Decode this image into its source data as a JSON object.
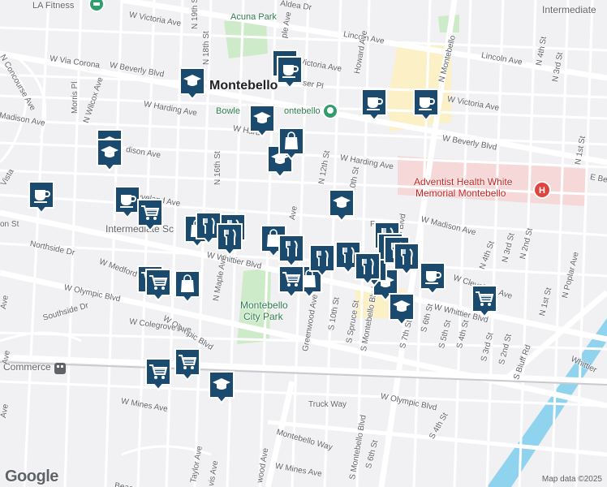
{
  "attribution": "Map data ©2025",
  "logo": "Google",
  "labels": [
    {
      "id": "la-fitness",
      "text": "LA Fitness",
      "cls": "poi-d"
    },
    {
      "id": "aldea",
      "text": "Aldea Dr",
      "cls": ""
    },
    {
      "id": "intermediate-top",
      "text": "Intermediate",
      "cls": "corner"
    },
    {
      "id": "acuna-park",
      "text": "Acuna Park",
      "cls": "poi-g"
    },
    {
      "id": "victoria-w1",
      "text": "W Victoria Ave",
      "cls": ""
    },
    {
      "id": "victoria-w2",
      "text": "Victoria Ave",
      "cls": ""
    },
    {
      "id": "lincoln-w",
      "text": "Lincoln Ave",
      "cls": ""
    },
    {
      "id": "lincoln-e",
      "text": "Lincoln Ave",
      "cls": ""
    },
    {
      "id": "via-corona",
      "text": "W Via Corona",
      "cls": ""
    },
    {
      "id": "beverly-w",
      "text": "W Beverly Blvd",
      "cls": ""
    },
    {
      "id": "beverly-e",
      "text": "W Beverly Blvd",
      "cls": ""
    },
    {
      "id": "concourse",
      "text": "N Concourse Ave",
      "cls": ""
    },
    {
      "id": "wilcox",
      "text": "N Wilcox Ave",
      "cls": ""
    },
    {
      "id": "morris",
      "text": "Morris Pl",
      "cls": ""
    },
    {
      "id": "montebello",
      "text": "Montebello",
      "cls": "city"
    },
    {
      "id": "harding-w",
      "text": "W Harding Ave",
      "cls": ""
    },
    {
      "id": "harding-c",
      "text": "W Hardi",
      "cls": ""
    },
    {
      "id": "harding-e",
      "text": "W Harding Ave",
      "cls": ""
    },
    {
      "id": "bowl",
      "text": "Bowle",
      "cls": "poi-g"
    },
    {
      "id": "bowl2",
      "text": "ontebello",
      "cls": "poi-g"
    },
    {
      "id": "madison-w",
      "text": "Madison Ave",
      "cls": ""
    },
    {
      "id": "madison-c",
      "text": "dison Ave",
      "cls": ""
    },
    {
      "id": "madison-e",
      "text": "W Madison Ave",
      "cls": ""
    },
    {
      "id": "vic-e",
      "text": "W Victoria Ave",
      "cls": ""
    },
    {
      "id": "n19",
      "text": "N 19th St",
      "cls": ""
    },
    {
      "id": "n18",
      "text": "N 18th St",
      "cls": ""
    },
    {
      "id": "n16",
      "text": "N 16th St",
      "cls": ""
    },
    {
      "id": "n12",
      "text": "N 12th St",
      "cls": ""
    },
    {
      "id": "n10",
      "text": "N 10th St",
      "cls": ""
    },
    {
      "id": "howard",
      "text": "Howard Ave",
      "cls": ""
    },
    {
      "id": "nmontebello-top",
      "text": "N Montebello",
      "cls": ""
    },
    {
      "id": "adventist1",
      "text": "Adventist Health White",
      "cls": "poi-r"
    },
    {
      "id": "adventist2",
      "text": "Memorial Montebello",
      "cls": "poi-r"
    },
    {
      "id": "cleveland-w",
      "text": "Cleveland Ave",
      "cls": ""
    },
    {
      "id": "cleveland-e",
      "text": "W Cleveland Ave",
      "cls": ""
    },
    {
      "id": "whittier-w",
      "text": "W Whittier Blvd",
      "cls": ""
    },
    {
      "id": "whittier-c",
      "text": "W Wh",
      "cls": ""
    },
    {
      "id": "whittier-e",
      "text": "W Whittier Blvd",
      "cls": ""
    },
    {
      "id": "whittier-far",
      "text": "Whittier",
      "cls": ""
    },
    {
      "id": "northside",
      "text": "Northside Dr",
      "cls": ""
    },
    {
      "id": "medford",
      "text": "W Medford",
      "cls": ""
    },
    {
      "id": "intermediate",
      "text": "Intermediate Sc",
      "cls": "place"
    },
    {
      "id": "olympic-w",
      "text": "W Olympic Blvd",
      "cls": ""
    },
    {
      "id": "olympic-c",
      "text": "W Olympic Blvd",
      "cls": ""
    },
    {
      "id": "olympic-e",
      "text": "W Olympic Blvd",
      "cls": ""
    },
    {
      "id": "southside",
      "text": "Southside Dr",
      "cls": ""
    },
    {
      "id": "colegrove",
      "text": "W Colegrove Ave",
      "cls": ""
    },
    {
      "id": "maple",
      "text": "N Maple Ave",
      "cls": ""
    },
    {
      "id": "city-park1",
      "text": "Montebello",
      "cls": "park"
    },
    {
      "id": "city-park2",
      "text": "City Park",
      "cls": "park"
    },
    {
      "id": "greenwood",
      "text": "Greenwood Ave",
      "cls": ""
    },
    {
      "id": "s10",
      "text": "S 10th St",
      "cls": ""
    },
    {
      "id": "spruce",
      "text": "S Spruce St",
      "cls": ""
    },
    {
      "id": "smontebello",
      "text": "S Montebello Blvd",
      "cls": ""
    },
    {
      "id": "s7",
      "text": "S 7th St",
      "cls": ""
    },
    {
      "id": "s6",
      "text": "S 6th St",
      "cls": ""
    },
    {
      "id": "s5",
      "text": "S 5th St",
      "cls": ""
    },
    {
      "id": "s4",
      "text": "S 4th St",
      "cls": ""
    },
    {
      "id": "s3",
      "text": "S 3rd St",
      "cls": ""
    },
    {
      "id": "s2",
      "text": "S 2nd St",
      "cls": ""
    },
    {
      "id": "sbluff",
      "text": "S Bluff Rd",
      "cls": ""
    },
    {
      "id": "n4",
      "text": "N 4th St",
      "cls": ""
    },
    {
      "id": "n3",
      "text": "N 3rd St",
      "cls": ""
    },
    {
      "id": "n2",
      "text": "N 2nd St",
      "cls": ""
    },
    {
      "id": "n1",
      "text": "N 1st St",
      "cls": ""
    },
    {
      "id": "n4b",
      "text": "N 4th St",
      "cls": ""
    },
    {
      "id": "n3b",
      "text": "N 3rd St",
      "cls": ""
    },
    {
      "id": "n1b",
      "text": "N 1st St",
      "cls": ""
    },
    {
      "id": "npoplar",
      "text": "N Poplar Ave",
      "cls": ""
    },
    {
      "id": "ebev",
      "text": "E Bev",
      "cls": ""
    },
    {
      "id": "commerce",
      "text": "Commerce",
      "cls": "place"
    },
    {
      "id": "mines-w",
      "text": "W Mines Ave",
      "cls": ""
    },
    {
      "id": "mines-c",
      "text": "W Mines Ave",
      "cls": ""
    },
    {
      "id": "truck",
      "text": "Truck Way",
      "cls": ""
    },
    {
      "id": "montebello-way",
      "text": "Montebello Way",
      "cls": ""
    },
    {
      "id": "s4b",
      "text": "S 4th St",
      "cls": ""
    },
    {
      "id": "s6b",
      "text": "S 6th St",
      "cls": ""
    },
    {
      "id": "smont2",
      "text": "S Montebello Blvd",
      "cls": ""
    },
    {
      "id": "taylor",
      "text": "Taylor Ave",
      "cls": ""
    },
    {
      "id": "vis",
      "text": "vis Ave",
      "cls": ""
    },
    {
      "id": "wood",
      "text": "wood Ave",
      "cls": ""
    },
    {
      "id": "beac",
      "text": "Beac",
      "cls": ""
    },
    {
      "id": "ston",
      "text": "on St",
      "cls": ""
    },
    {
      "id": "vista",
      "text": "Vista",
      "cls": ""
    },
    {
      "id": "ave-left",
      "text": "Ave",
      "cls": ""
    },
    {
      "id": "ave-left2",
      "text": "Ave",
      "cls": ""
    },
    {
      "id": "ave-left3",
      "text": "Ave",
      "cls": ""
    },
    {
      "id": "ser-pl",
      "text": "ser Pl",
      "cls": ""
    },
    {
      "id": "n-elm",
      "text": "ple Ave",
      "cls": ""
    },
    {
      "id": "blvd-part",
      "text": "o Blvd",
      "cls": ""
    },
    {
      "id": "pl-part",
      "text": "P",
      "cls": ""
    },
    {
      "id": "ave-part",
      "text": "Ave",
      "cls": ""
    }
  ],
  "markers": [
    {
      "id": "coffee-1",
      "type": "coffee"
    },
    {
      "id": "coffee-2",
      "type": "coffee"
    },
    {
      "id": "coffee-3",
      "type": "coffee"
    },
    {
      "id": "coffee-4",
      "type": "coffee"
    },
    {
      "id": "coffee-5",
      "type": "coffee"
    },
    {
      "id": "coffee-6",
      "type": "coffee"
    },
    {
      "id": "coffee-7",
      "type": "coffee"
    },
    {
      "id": "school-1",
      "type": "school"
    },
    {
      "id": "school-2",
      "type": "school"
    },
    {
      "id": "school-3",
      "type": "school"
    },
    {
      "id": "school-4",
      "type": "school"
    },
    {
      "id": "school-5",
      "type": "school"
    },
    {
      "id": "school-6",
      "type": "school"
    },
    {
      "id": "school-7",
      "type": "school"
    },
    {
      "id": "school-8",
      "type": "school"
    },
    {
      "id": "school-9",
      "type": "school"
    },
    {
      "id": "shop-1",
      "type": "shop"
    },
    {
      "id": "shop-2",
      "type": "shop"
    },
    {
      "id": "shop-3",
      "type": "shop"
    },
    {
      "id": "shop-4",
      "type": "shop"
    },
    {
      "id": "shop-5",
      "type": "shop"
    },
    {
      "id": "shop-6",
      "type": "shop"
    },
    {
      "id": "cart-1",
      "type": "cart"
    },
    {
      "id": "cart-2",
      "type": "cart"
    },
    {
      "id": "cart-3",
      "type": "cart"
    },
    {
      "id": "cart-4",
      "type": "cart"
    },
    {
      "id": "cart-5",
      "type": "cart"
    },
    {
      "id": "cart-6",
      "type": "cart"
    },
    {
      "id": "cart-7",
      "type": "cart"
    },
    {
      "id": "food-1",
      "type": "food"
    },
    {
      "id": "food-2",
      "type": "food"
    },
    {
      "id": "food-3",
      "type": "food"
    },
    {
      "id": "food-4",
      "type": "food"
    },
    {
      "id": "food-5",
      "type": "food"
    },
    {
      "id": "food-6",
      "type": "food"
    },
    {
      "id": "food-7",
      "type": "food"
    },
    {
      "id": "food-8",
      "type": "food"
    },
    {
      "id": "food-9",
      "type": "food"
    },
    {
      "id": "food-10",
      "type": "food"
    },
    {
      "id": "food-11",
      "type": "food"
    }
  ],
  "colors": {
    "marker_fill": "#1a4b6e",
    "marker_border": "#ffffff",
    "road": "#ffffff",
    "bg": "#f1f1f3",
    "park": "#cdebc9",
    "hospital": "#f6d8d8",
    "yellow": "#fbf0c6",
    "river": "#8fd3ee",
    "highway": "#ffffff"
  },
  "icons": {
    "coffee": "coffee-cup-icon",
    "school": "graduation-cap-icon",
    "shop": "shopping-bag-icon",
    "cart": "shopping-cart-icon",
    "food": "fork-knife-icon",
    "fitness": "fitness-pin-icon",
    "park": "park-pin-icon",
    "hospital": "hospital-pin-icon"
  }
}
